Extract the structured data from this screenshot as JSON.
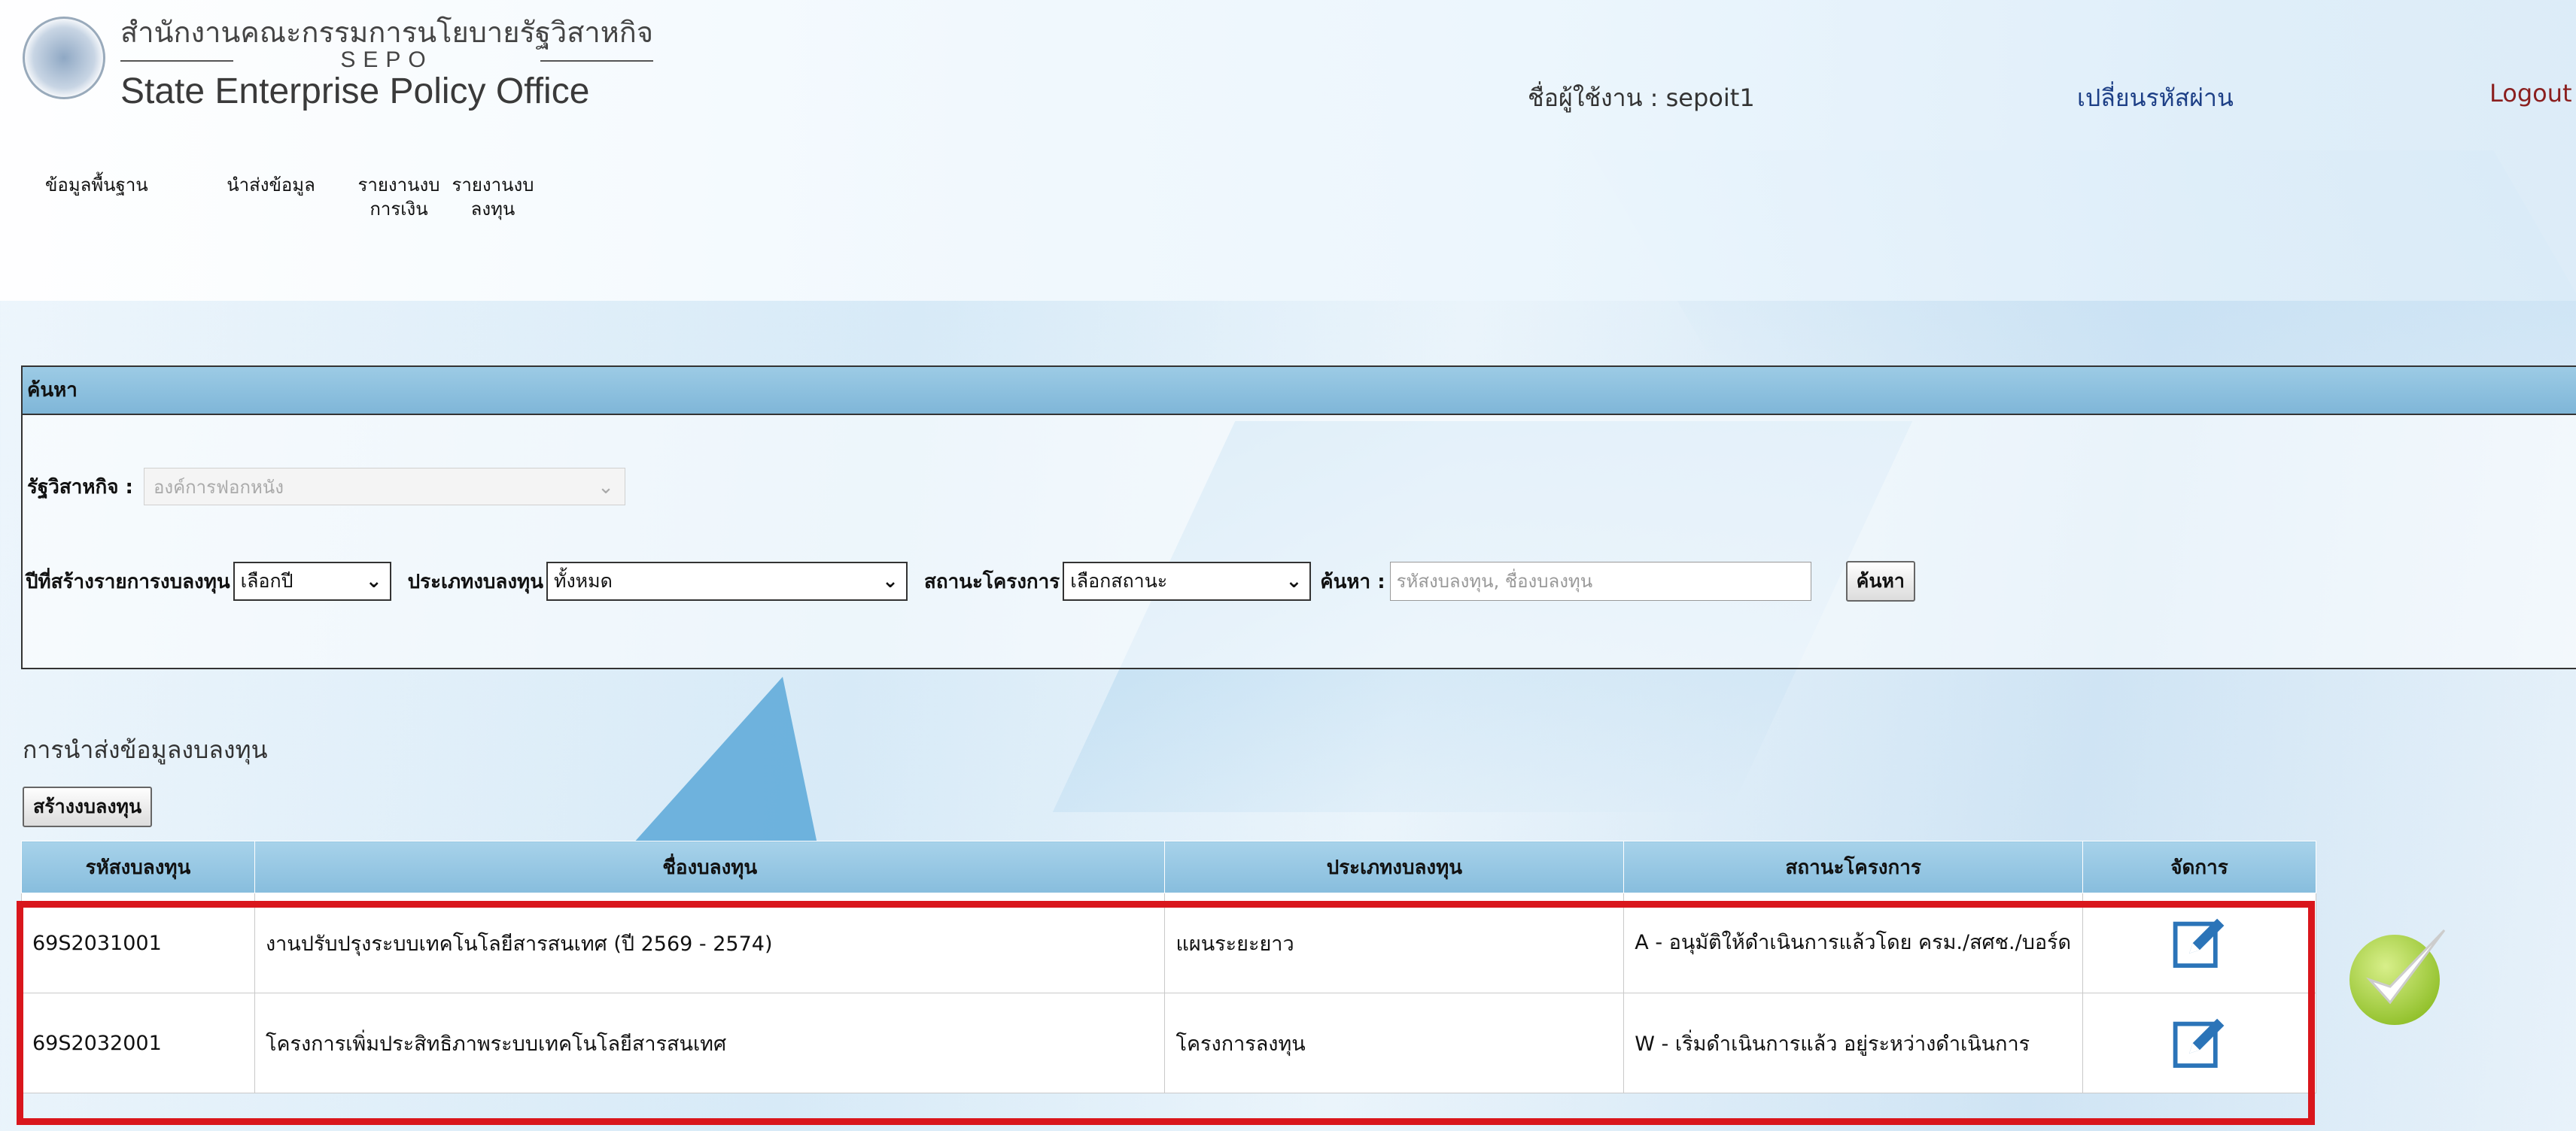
{
  "header": {
    "logo_thai": "สำนักงานคณะกรรมการนโยบายรัฐวิสาหกิจ",
    "logo_sepo": "SEPO",
    "logo_english": "State Enterprise Policy Office",
    "user_label": "ชื่อผู้ใช้งาน : sepoit1",
    "change_password": "เปลี่ยนรหัสผ่าน",
    "logout": "Logout"
  },
  "nav": {
    "items": [
      {
        "line1": "ข้อมูลพื้นฐาน",
        "line2": ""
      },
      {
        "line1": "นำส่งข้อมูล",
        "line2": ""
      },
      {
        "line1": "รายงานงบ",
        "line2": "การเงิน"
      },
      {
        "line1": "รายงานงบ",
        "line2": "ลงทุน"
      }
    ]
  },
  "search": {
    "title": "ค้นหา",
    "enterprise_label": "รัฐวิสาหกิจ :",
    "enterprise_value": "องค์การฟอกหนัง",
    "year_label": "ปีที่สร้างรายการงบลงทุน",
    "year_value": "เลือกปี",
    "type_label": "ประเภทงบลงทุน",
    "type_value": "ทั้งหมด",
    "status_label": "สถานะโครงการ",
    "status_value": "เลือกสถานะ",
    "keyword_label": "ค้นหา :",
    "keyword_placeholder": "รหัสงบลงทุน, ชื่องบลงทุน",
    "search_button": "ค้นหา"
  },
  "section": {
    "title": "การนำส่งข้อมูลงบลงทุน",
    "create_button": "สร้างงบลงทุน"
  },
  "table": {
    "headers": [
      "รหัสงบลงทุน",
      "ชื่องบลงทุน",
      "ประเภทงบลงทุน",
      "สถานะโครงการ",
      "จัดการ"
    ],
    "rows": [
      {
        "code": "69S2031001",
        "name": "งานปรับปรุงระบบเทคโนโลยีสารสนเทศ (ปี 2569 - 2574)",
        "type": "แผนระยะยาว",
        "status": "A - อนุมัติให้ดำเนินการแล้วโดย ครม./สศช./บอร์ด"
      },
      {
        "code": "69S2032001",
        "name": "โครงการเพิ่มประสิทธิภาพระบบเทคโนโลยีสารสนเทศ",
        "type": "โครงการลงทุน",
        "status": "W - เริ่มดำเนินการแล้ว อยู่ระหว่างดำเนินการ"
      }
    ]
  },
  "icons": {
    "edit": "edit-icon",
    "check": "check-icon",
    "chevron": "chevron-down-icon",
    "seal": "seal-logo"
  },
  "colors": {
    "header_bar": "#87bddd",
    "highlight": "#d9161c",
    "edit_icon": "#2b74b8",
    "check_icon": "#a6d33a"
  }
}
